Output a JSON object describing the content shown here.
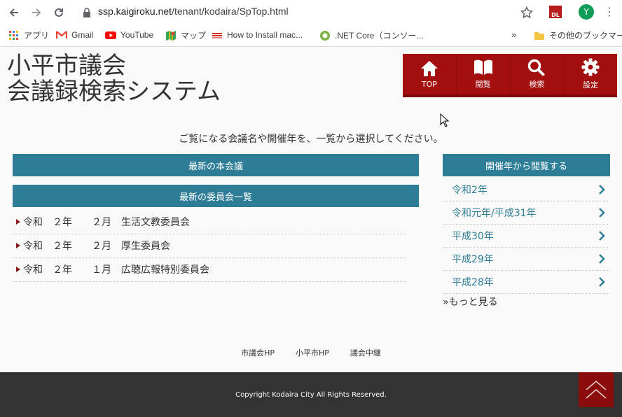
{
  "browser": {
    "url_domain": "ssp.kaigiroku.net",
    "url_path": "/tenant/kodaira/SpTop.html",
    "profile_initial": "Y",
    "bookmarks": [
      {
        "label": "アプリ",
        "icon": "apps-grid-icon"
      },
      {
        "label": "Gmail",
        "icon": "gmail-icon"
      },
      {
        "label": "YouTube",
        "icon": "youtube-icon"
      },
      {
        "label": "マップ",
        "icon": "maps-icon"
      },
      {
        "label": "How to Install mac...",
        "icon": "bookmark-icon"
      },
      {
        "label": ".NET Core（コンソー...",
        "icon": "bookmark-icon"
      }
    ],
    "overflow": "»",
    "other_bookmarks": "その他のブックマーク"
  },
  "site": {
    "title_line1": "小平市議会",
    "title_line2": "会議録検索システム"
  },
  "menu": [
    {
      "label": "TOP",
      "icon": "home-icon"
    },
    {
      "label": "閲覧",
      "icon": "book-icon"
    },
    {
      "label": "検索",
      "icon": "search-icon"
    },
    {
      "label": "設定",
      "icon": "gear-icon"
    }
  ],
  "intro": "ご覧になる会議名や開催年を、一覧から選択してください。",
  "latest_plenary": "最新の本会議",
  "latest_committee": "最新の委員会一覧",
  "committee_list": [
    "令和　２年　　２月　生活文教委員会",
    "令和　２年　　２月　厚生委員会",
    "令和　２年　　１月　広聴広報特別委員会"
  ],
  "year_header": "開催年から閲覧する",
  "years": [
    "令和2年",
    "令和元年/平成31年",
    "平成30年",
    "平成29年",
    "平成28年"
  ],
  "more": "»もっと見る",
  "footer_links": [
    "市議会HP",
    "小平市HP",
    "議会中継"
  ],
  "copyright": "Copyright Kodaira City All Rights Reserved.",
  "colors": {
    "accent_red": "#a30f0f",
    "teal": "#2e7d96"
  }
}
